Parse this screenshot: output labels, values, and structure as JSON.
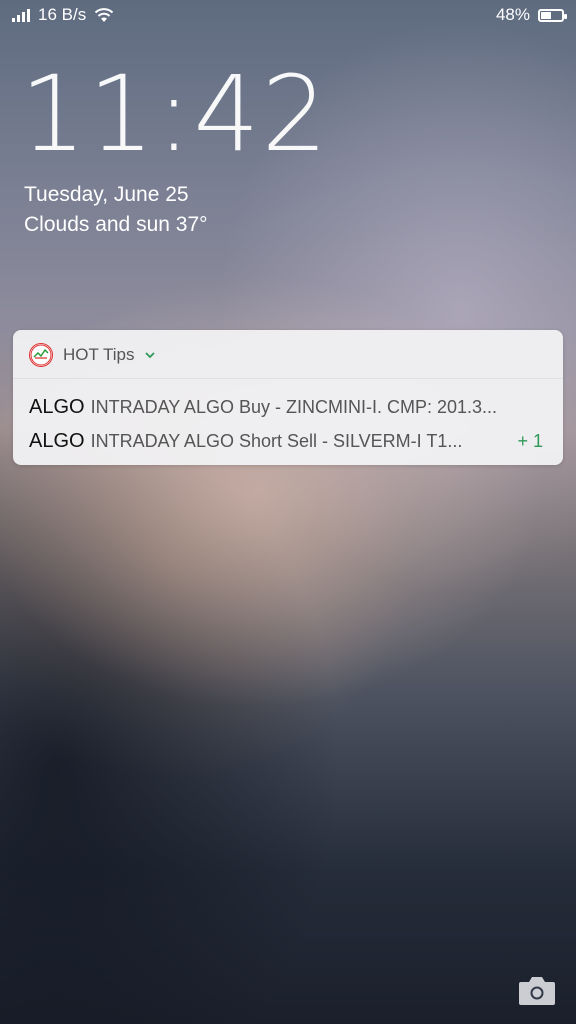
{
  "status_bar": {
    "network_speed": "16 B/s",
    "battery_percent": "48%",
    "battery_level": 0.48,
    "icons": [
      "signal-icon",
      "wifi-icon",
      "battery-icon"
    ]
  },
  "lockscreen": {
    "time": "11:42",
    "date": "Tuesday, June 25",
    "weather": "Clouds and sun 37°"
  },
  "notification": {
    "app_name": "HOT Tips",
    "app_logo_text": "HOT tips",
    "items": [
      {
        "sender": "ALGO",
        "message": "INTRADAY ALGO Buy - ZINCMINI-I. CMP: 201.3..."
      },
      {
        "sender": "ALGO",
        "message": "INTRADAY ALGO Short Sell - SILVERM-I T1..."
      }
    ],
    "more_count": "+ 1",
    "accent_color": "#2e9a58"
  },
  "shortcuts": {
    "camera_icon": "camera-icon"
  }
}
